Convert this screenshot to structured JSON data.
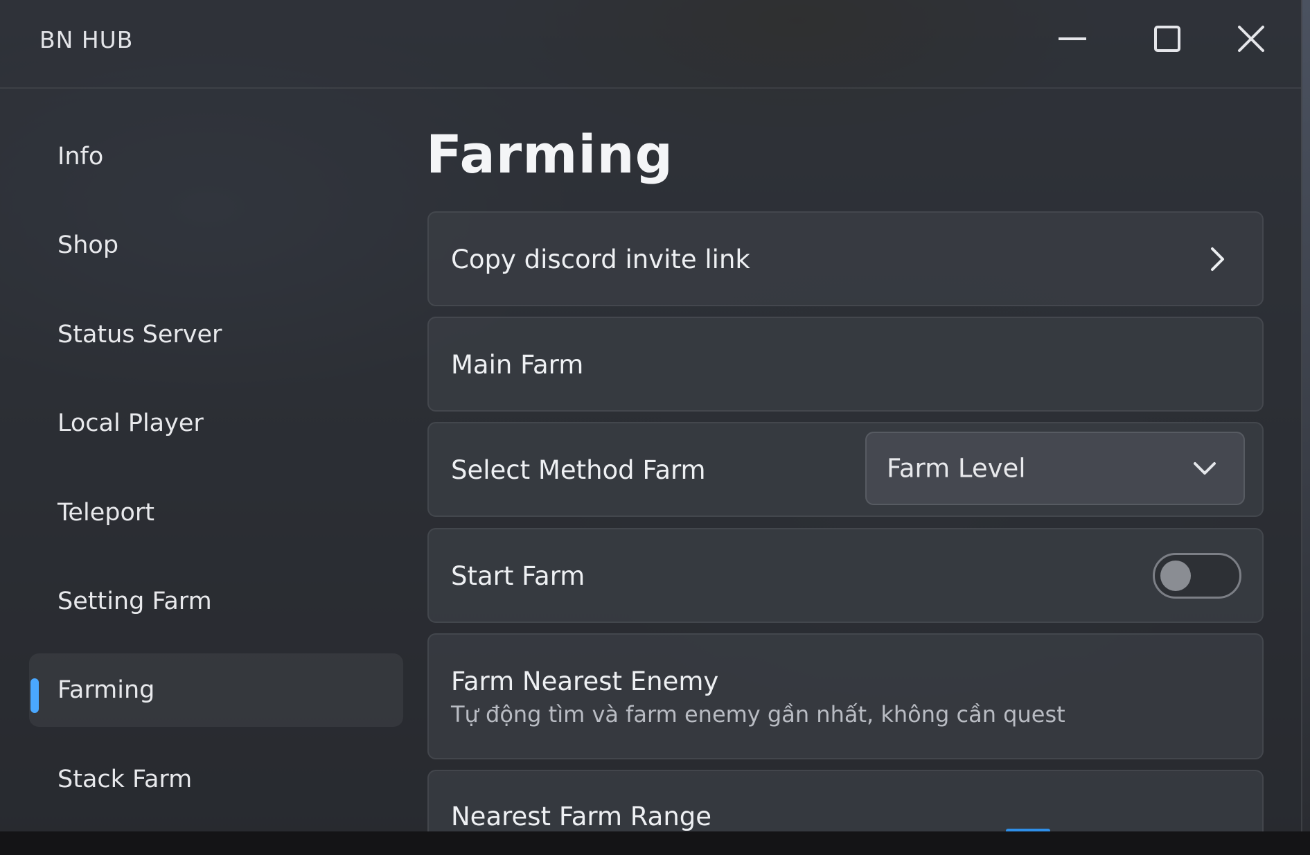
{
  "window": {
    "title": "BN HUB",
    "controls": {
      "minimize": "minimize-icon",
      "maximize": "maximize-icon",
      "close": "close-icon"
    }
  },
  "sidebar": {
    "items": [
      {
        "label": "Info",
        "active": false
      },
      {
        "label": "Shop",
        "active": false
      },
      {
        "label": "Status Server",
        "active": false
      },
      {
        "label": "Local Player",
        "active": false
      },
      {
        "label": "Teleport",
        "active": false
      },
      {
        "label": "Setting Farm",
        "active": false
      },
      {
        "label": "Farming",
        "active": true
      },
      {
        "label": "Stack Farm",
        "active": false
      }
    ],
    "active_indicator_color": "#4aa8ff"
  },
  "main": {
    "title": "Farming",
    "copy_discord": {
      "label": "Copy discord invite link",
      "icon": "chevron-right-icon"
    },
    "main_farm": {
      "label": "Main Farm"
    },
    "select_method": {
      "label": "Select Method Farm",
      "value": "Farm Level",
      "icon": "chevron-down-icon"
    },
    "start_farm": {
      "label": "Start Farm",
      "enabled": false
    },
    "farm_nearest": {
      "label": "Farm Nearest Enemy",
      "description": "Tự động tìm và farm enemy gần nhất, không cần quest"
    },
    "nearest_range": {
      "label": "Nearest Farm Range"
    }
  },
  "colors": {
    "accent": "#4aa8ff",
    "panel": "#282a30",
    "card": "#3a3d44",
    "text": "#eef0f3"
  }
}
